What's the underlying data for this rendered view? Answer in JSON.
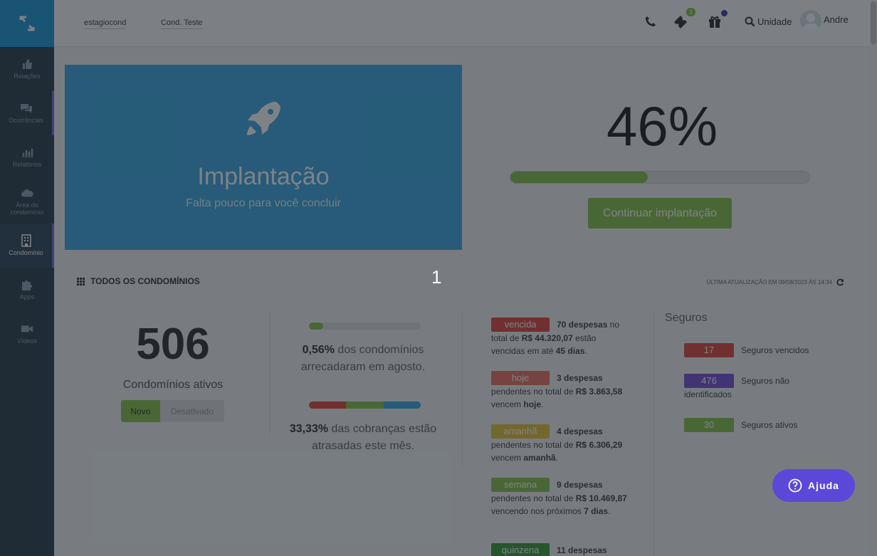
{
  "breadcrumbs": [
    "estagiocond",
    "Cond. Teste"
  ],
  "topbar": {
    "ticket_badge": "3",
    "unit_label": "Unidade",
    "user_name": "Andre"
  },
  "sidebar": {
    "items": [
      {
        "label": "Relações",
        "icon": "thumbs-up-icon"
      },
      {
        "label": "Ocorrências",
        "icon": "comments-icon"
      },
      {
        "label": "Relatórios",
        "icon": "bar-chart-icon"
      },
      {
        "label": "Área do condomínio",
        "icon": "cloud-icon"
      },
      {
        "label": "Condomínio",
        "icon": "building-icon"
      },
      {
        "label": "Apps",
        "icon": "puzzle-icon"
      },
      {
        "label": "Vídeos",
        "icon": "video-icon"
      }
    ],
    "active_index": 4
  },
  "hero": {
    "title": "Implantação",
    "subtitle": "Falta pouco para você concluir",
    "icon": "rocket-icon",
    "color": "#3ea9e0"
  },
  "progress": {
    "percent_text": "46%",
    "value": 0.46,
    "button_label": "Continuar implantação"
  },
  "section": {
    "title": "TODOS OS CONDOMÍNIOS",
    "updated": "ÚLTIMA ATUALIZAÇÃO EM 09/08/2023 ÀS 14:34"
  },
  "step_number": "1",
  "condos": {
    "count": "506",
    "label": "Condomínios ativos",
    "toggle_active": "Novo",
    "toggle_inactive": "Desativado"
  },
  "stats": [
    {
      "percent": "0,56%",
      "text": "dos condomínios arrecadaram em agosto.",
      "fill": 0.13
    },
    {
      "percent": "33,33%",
      "text": "das cobranças estão atrasadas este mês."
    }
  ],
  "expenses": [
    {
      "tag": "vencida",
      "color": "#e04b3c",
      "count": "70 despesas",
      "t1": " no total de ",
      "amount": "R$ 44.320,07",
      "t2": " estão vencidas em até ",
      "when": "45 dias",
      "t3": "."
    },
    {
      "tag": "hoje",
      "color": "#ee7461",
      "count": "3 despesas",
      "t1": " pendentes no total de ",
      "amount": "R$ 3.863,58",
      "t2": " vencem ",
      "when": "hoje",
      "t3": "."
    },
    {
      "tag": "amanhã",
      "color": "#e7c43a",
      "count": "4 despesas",
      "t1": " pendentes no total de ",
      "amount": "R$ 6.306,29",
      "t2": " vencem ",
      "when": "amanhã",
      "t3": "."
    },
    {
      "tag": "semana",
      "color": "#8bc34a",
      "count": "9 despesas",
      "t1": " pendentes no total de ",
      "amount": "R$ 10.469,87",
      "t2": " vencendo nos próximos ",
      "when": "7 dias",
      "t3": "."
    },
    {
      "tag": "quinzena",
      "color": "#3f9c35",
      "count": "11 despesas",
      "t1": "",
      "amount": "",
      "t2": "",
      "when": "",
      "t3": ""
    }
  ],
  "insurance": {
    "title": "Seguros",
    "items": [
      {
        "count": "17",
        "label": "Seguros vencidos",
        "color": "#e04b3c"
      },
      {
        "count": "476",
        "label": "Seguros não identificados",
        "color": "#7b52d6"
      },
      {
        "count": "30",
        "label": "Seguros ativos",
        "color": "#8bc34a"
      }
    ]
  },
  "help": {
    "label": "Ajuda"
  }
}
